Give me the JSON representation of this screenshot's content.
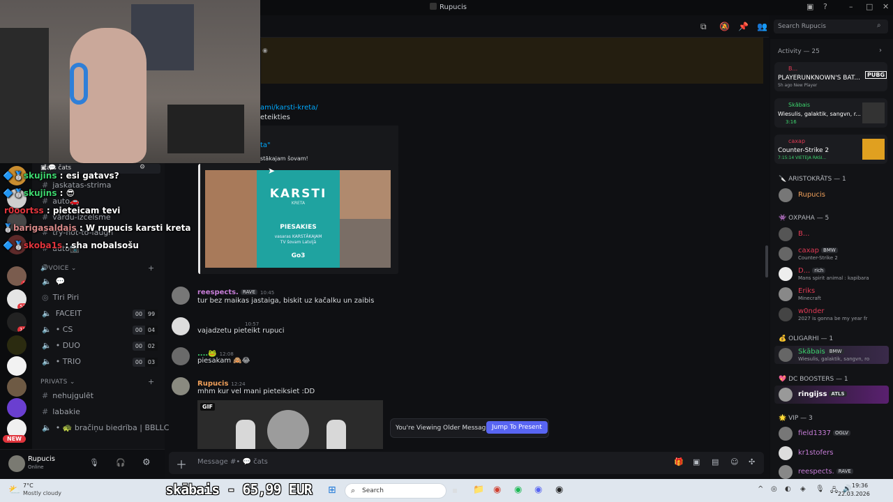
{
  "window": {
    "title": "Rupucis"
  },
  "overlay_chat": [
    {
      "user": "skujins",
      "text": ": esi gatavs?",
      "color": "#3dd66e"
    },
    {
      "user": "skujins",
      "text": ": 😎",
      "color": "#3dd66e"
    },
    {
      "user": "r0oortss",
      "text": ": pieteicam tevi",
      "color": "#e0343c"
    },
    {
      "user": "barigasaldais",
      "text": ": W rupucis karsti kreta",
      "color": "#d98a8a"
    },
    {
      "user": "skoba1s",
      "text": ": sha nobalsošu",
      "color": "#e0343c"
    }
  ],
  "sidebar": {
    "current_channel": "čats",
    "channels_top": [
      "jaskatas-strima",
      "auto🚗",
      "vārdu-izcelsme",
      "try-hot-to-laugh",
      "auto📷"
    ],
    "voice_category": "VOICE",
    "voice_channels": [
      {
        "name": "💬",
        "counts": null
      },
      {
        "name": "Tiri Piri",
        "counts": null
      },
      {
        "name": "FACEIT",
        "counts": [
          "00",
          "99"
        ]
      },
      {
        "name": "• CS",
        "counts": [
          "00",
          "04"
        ]
      },
      {
        "name": "• DUO",
        "counts": [
          "00",
          "02"
        ]
      },
      {
        "name": "• TRIO",
        "counts": [
          "00",
          "03"
        ]
      }
    ],
    "private_category": "PRIVATS",
    "private_channels": [
      "nehujgulēt",
      "labakie",
      "• 🐢 bračiņu biedrība | BBLLC"
    ],
    "new_badge": "NEW",
    "server_badges": [
      "3",
      "53",
      "13"
    ]
  },
  "user_panel": {
    "name": "Rupucis",
    "status": "Online"
  },
  "chat": {
    "link_line": "ami/karsti-kreta/",
    "link_line2": "eteikties",
    "embed_title": "ta\"",
    "embed_desc": "stākajam šovam!",
    "promo": {
      "brand": "KARSTI",
      "sub": "KRETA",
      "cta": "PIESAKIES",
      "small1": "vasaras KARSTĀKAJAM",
      "small2": "TV šovam Latvijā",
      "logo": "Go3"
    },
    "messages": [
      {
        "author": "reespects.",
        "tag": "RAVE",
        "time": "10:45",
        "text": "tur bez maikas jastaiga, biskit uz kačalku un zaibis",
        "color": "#c77dd8"
      },
      {
        "author": "",
        "tag": "",
        "time": "10:57",
        "text": "vajadzetu pieteikt rupuci",
        "color": "#dbdee1"
      },
      {
        "author": "....🐸",
        "tag": "",
        "time": "12:08",
        "text": "piesakam 🙈😂",
        "color": "#3dd66e"
      },
      {
        "author": "Rupucis",
        "tag": "",
        "time": "12:24",
        "text": "mhm kur vel mani pieteiksiet :DD",
        "color": "#f0a05a"
      }
    ],
    "gif_label": "GIF",
    "older_notice": "You're Viewing Older Messages",
    "jump_label": "Jump To Present",
    "composer_placeholder": "Message #• 💬 čats"
  },
  "right": {
    "search_placeholder": "Search Rupucis",
    "activity_header": "Activity — 25",
    "activity": [
      {
        "user": "B...",
        "game": "PLAYERUNKNOWN'S BAT...",
        "meta": "5h ago  New Player",
        "icon": "PUBG"
      },
      {
        "user": "Skābais",
        "game": "Wiesulis, galaktik, sangvn, r...",
        "meta": "3:16"
      },
      {
        "user": "сахар",
        "game": "Counter-Strike 2",
        "meta": "7:15:14  VIETEJA RASI..."
      }
    ],
    "groups": [
      {
        "title": "ARISTOKRĀTS — 1",
        "members": [
          {
            "name": "Rupucis",
            "color": "#f0a05a",
            "status": ""
          }
        ]
      },
      {
        "title": "ОХРАНА — 5",
        "members": [
          {
            "name": "B...",
            "color": "#e23a55",
            "status": ""
          },
          {
            "name": "сахар",
            "color": "#e23a55",
            "tag": "BMW",
            "status": "Counter-Strike 2"
          },
          {
            "name": "D...",
            "color": "#e23a55",
            "tag": "rich",
            "status": "Mans spirit animal : kapibara"
          },
          {
            "name": "Eriks",
            "color": "#e23a55",
            "status": "Minecraft"
          },
          {
            "name": "w0nder",
            "color": "#e23a55",
            "status": "2027 is gonna be my year fr"
          }
        ]
      },
      {
        "title": "OLIGARHI — 1",
        "members": [
          {
            "name": "Skābais",
            "color": "#3dd66e",
            "tag": "BMW",
            "status": "Wiesulis, galaktik, sangvn, ro"
          }
        ]
      },
      {
        "title": "DC BOOSTERS — 1",
        "members": [
          {
            "name": "ringijss",
            "color": "#ffffff",
            "tag": "ATLS",
            "status": ""
          }
        ]
      },
      {
        "title": "VIP — 3",
        "members": [
          {
            "name": "field1337",
            "color": "#c77dd8",
            "tag": "OGLV",
            "status": ""
          },
          {
            "name": "kr1stofers",
            "color": "#c77dd8",
            "status": ""
          },
          {
            "name": "reespects.",
            "color": "#c77dd8",
            "tag": "RAVE",
            "status": ""
          }
        ]
      }
    ]
  },
  "taskbar": {
    "weather_temp": "7°C",
    "weather_desc": "Mostly cloudy",
    "stream_text": "skābais - 65,99 EUR",
    "search_label": "Search",
    "time": "19:36",
    "date": "22.03.2026"
  }
}
